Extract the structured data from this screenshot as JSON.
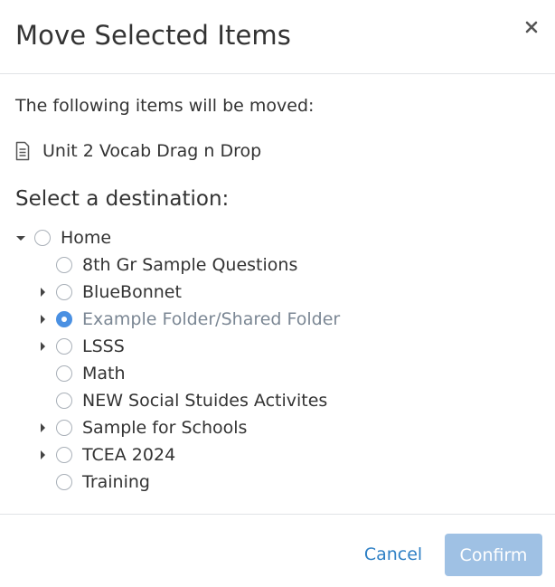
{
  "dialog": {
    "title": "Move Selected Items",
    "close_icon": "close-icon",
    "intro_text": "The following items will be moved:",
    "items": [
      {
        "icon": "document-icon",
        "label": "Unit 2 Vocab Drag n Drop"
      }
    ],
    "destination_heading": "Select a destination:"
  },
  "tree": {
    "root": {
      "label": "Home",
      "expanded": true,
      "selected": false
    },
    "children": [
      {
        "label": "8th Gr Sample Questions",
        "has_children": false,
        "selected": false
      },
      {
        "label": "BlueBonnet",
        "has_children": true,
        "selected": false
      },
      {
        "label": "Example Folder/Shared Folder",
        "has_children": true,
        "selected": true
      },
      {
        "label": "LSSS",
        "has_children": true,
        "selected": false
      },
      {
        "label": "Math",
        "has_children": false,
        "selected": false
      },
      {
        "label": "NEW Social Stuides Activites",
        "has_children": false,
        "selected": false
      },
      {
        "label": "Sample for Schools",
        "has_children": true,
        "selected": false
      },
      {
        "label": "TCEA 2024",
        "has_children": true,
        "selected": false
      },
      {
        "label": "Training",
        "has_children": false,
        "selected": false
      }
    ]
  },
  "footer": {
    "cancel_label": "Cancel",
    "confirm_label": "Confirm",
    "confirm_enabled": false
  },
  "colors": {
    "link": "#2f80c5",
    "primary_disabled": "#9fc1e4",
    "radio_selected": "#4a90e2",
    "muted_text": "#7b8794",
    "divider": "#e1e3e6"
  }
}
